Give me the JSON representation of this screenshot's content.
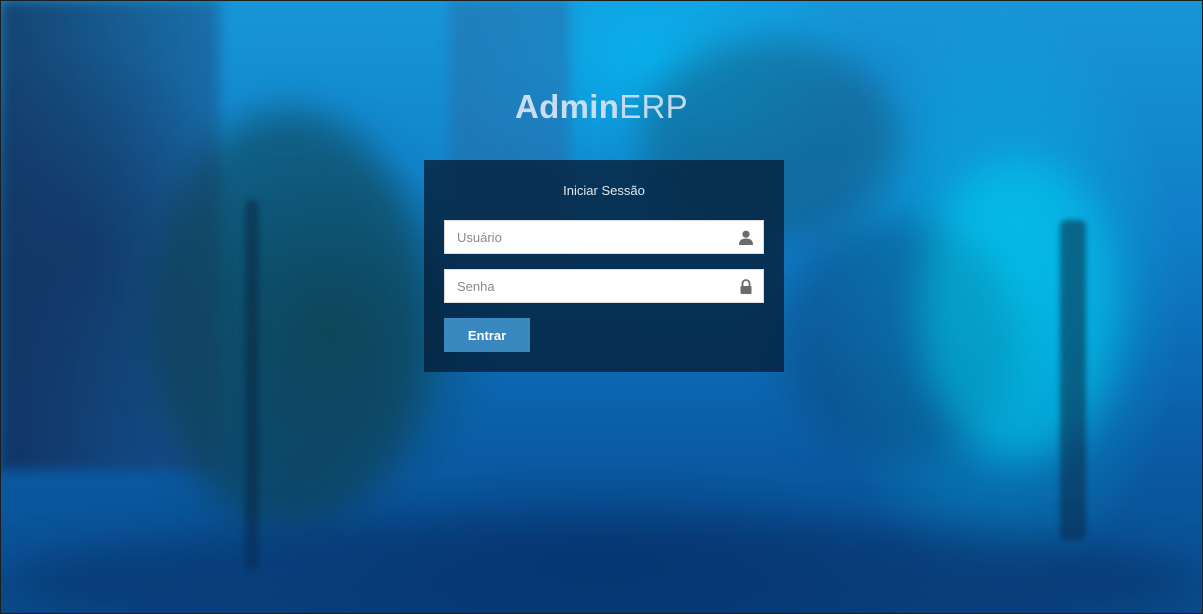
{
  "brand": {
    "bold": "Admin",
    "light": "ERP"
  },
  "login": {
    "title": "Iniciar Sessão",
    "username": {
      "placeholder": "Usuário",
      "value": "",
      "icon": "user-icon"
    },
    "password": {
      "placeholder": "Senha",
      "value": "",
      "icon": "lock-icon"
    },
    "submit_label": "Entrar"
  },
  "colors": {
    "panel_bg": "#05213a",
    "button_bg": "#3a88c0",
    "brand_text": "#c8ddf0"
  }
}
